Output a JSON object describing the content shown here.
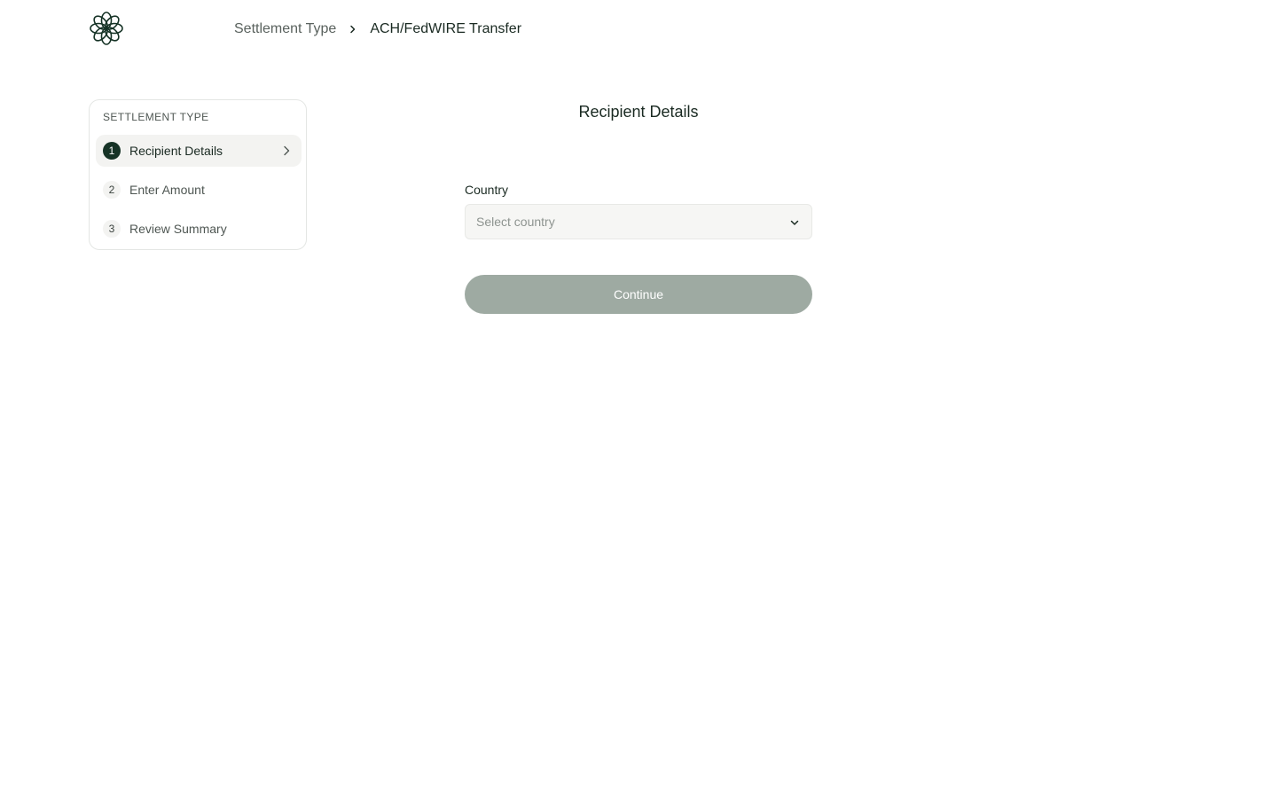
{
  "header": {
    "logo_icon": "flower-logo-icon",
    "breadcrumb": {
      "root": "Settlement Type",
      "separator_icon": "chevron-right-icon",
      "current": "ACH/FedWIRE Transfer"
    }
  },
  "stepper": {
    "title": "SETTLEMENT TYPE",
    "steps": [
      {
        "number": "1",
        "label": "Recipient Details",
        "active": true
      },
      {
        "number": "2",
        "label": "Enter Amount",
        "active": false
      },
      {
        "number": "3",
        "label": "Review Summary",
        "active": false
      }
    ],
    "active_chevron_icon": "chevron-right-icon"
  },
  "form": {
    "title": "Recipient Details",
    "country_label": "Country",
    "country_placeholder": "Select country",
    "country_chevron_icon": "chevron-down-icon",
    "continue_label": "Continue"
  },
  "colors": {
    "brand_dark": "#163326",
    "button_disabled": "#9eaaa2",
    "active_step_bg": "#f3f3f1"
  }
}
